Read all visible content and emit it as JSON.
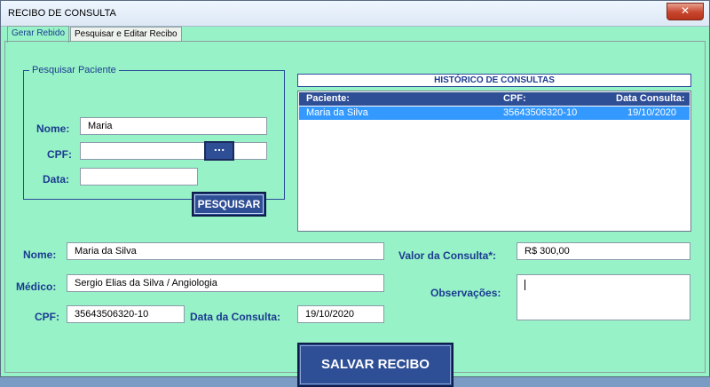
{
  "window": {
    "title": "RECIBO DE CONSULTA",
    "close_glyph": "✕"
  },
  "tabs": [
    {
      "label": "Gerar Rebido",
      "active": true
    },
    {
      "label": "Pesquisar e Editar Recibo",
      "active": false
    }
  ],
  "search": {
    "legend": "Pesquisar Paciente",
    "nome_label": "Nome:",
    "nome_value": "Maria",
    "cpf_label": "CPF:",
    "cpf_value": "",
    "data_label": "Data:",
    "data_value": "",
    "date_button": "...",
    "search_button": "PESQUISAR"
  },
  "history": {
    "title": "HISTÓRICO DE CONSULTAS",
    "columns": [
      "Paciente:",
      "CPF:",
      "Data Consulta:"
    ],
    "rows": [
      [
        "Maria da Silva",
        "35643506320-10",
        "19/10/2020"
      ]
    ]
  },
  "form": {
    "nome_label": "Nome:",
    "nome_value": "Maria da Silva",
    "medico_label": "Médico:",
    "medico_value": "Sergio Elias da Silva / Angiologia",
    "cpf_label": "CPF:",
    "cpf_value": "35643506320-10",
    "data_label": "Data da Consulta:",
    "data_value": "19/10/2020",
    "valor_label": "Valor da Consulta*:",
    "valor_value": "R$ 300,00",
    "obs_label": "Observações:",
    "obs_value": ""
  },
  "save_button": "SALVAR RECIBO",
  "colors": {
    "background": "#98f2c8",
    "accent": "#2e4e96",
    "label": "#1a3a90",
    "selection": "#3399ff"
  }
}
